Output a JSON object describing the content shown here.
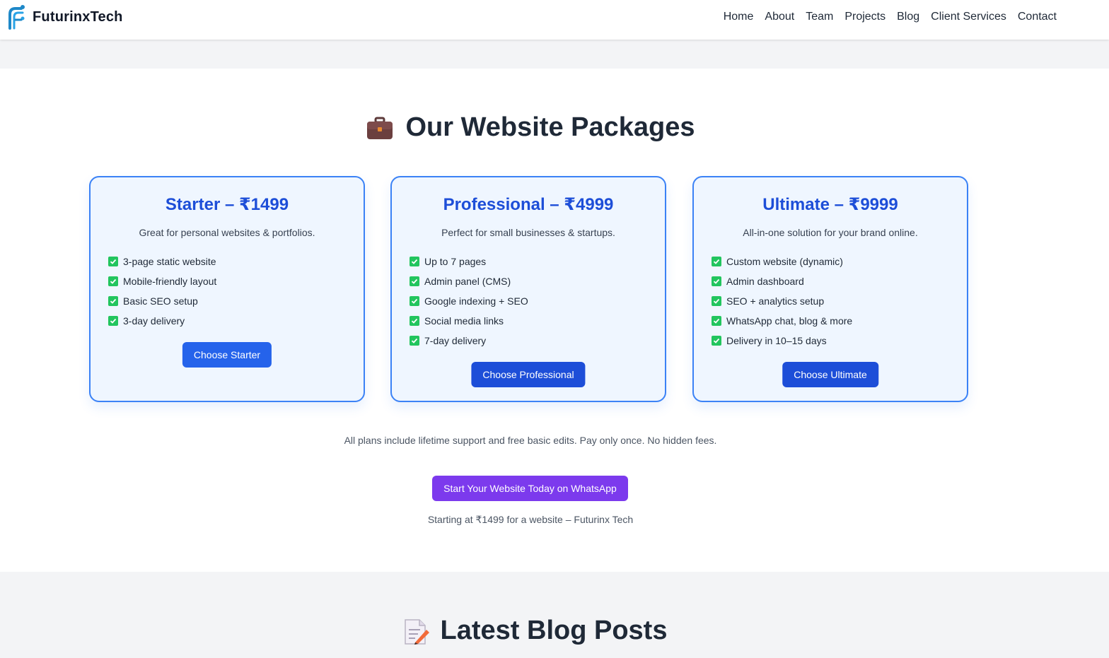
{
  "brand": {
    "name": "FuturinxTech",
    "logo_icon": "futurinx-logo-icon",
    "accent": "#3b82f6"
  },
  "nav": {
    "links": [
      "Home",
      "About",
      "Team",
      "Projects",
      "Blog",
      "Client Services",
      "Contact"
    ]
  },
  "packages": {
    "title": "Our Website Packages",
    "title_icon": "briefcase-icon",
    "cards": [
      {
        "title": "Starter – ₹1499",
        "description": "Great for personal websites & portfolios.",
        "features": [
          "3-page static website",
          "Mobile-friendly layout",
          "Basic SEO setup",
          "3-day delivery"
        ],
        "button_label": "Choose Starter",
        "button_color": "#2563eb"
      },
      {
        "title": "Professional – ₹4999",
        "description": "Perfect for small businesses & startups.",
        "features": [
          "Up to 7 pages",
          "Admin panel (CMS)",
          "Google indexing + SEO",
          "Social media links",
          "7-day delivery"
        ],
        "button_label": "Choose Professional",
        "button_color": "#1d4ed8"
      },
      {
        "title": "Ultimate – ₹9999",
        "description": "All-in-one solution for your brand online.",
        "features": [
          "Custom website (dynamic)",
          "Admin dashboard",
          "SEO + analytics setup",
          "WhatsApp chat, blog & more",
          "Delivery in 10–15 days"
        ],
        "button_label": "Choose Ultimate",
        "button_color": "#1d4ed8"
      }
    ],
    "note": "All plans include lifetime support and free basic edits. Pay only once. No hidden fees.",
    "whatsapp_button": "Start Your Website Today on WhatsApp",
    "whatsapp_color": "#7c3aed",
    "tagline": "Starting at ₹1499 for a website – Futurinx Tech"
  },
  "blog": {
    "title": "Latest Blog Posts",
    "title_icon": "memo-icon"
  },
  "colors": {
    "check": "#22c55e",
    "card_border": "#3b82f6",
    "card_bg": "#eff6ff",
    "card_title": "#1d4ed8"
  }
}
